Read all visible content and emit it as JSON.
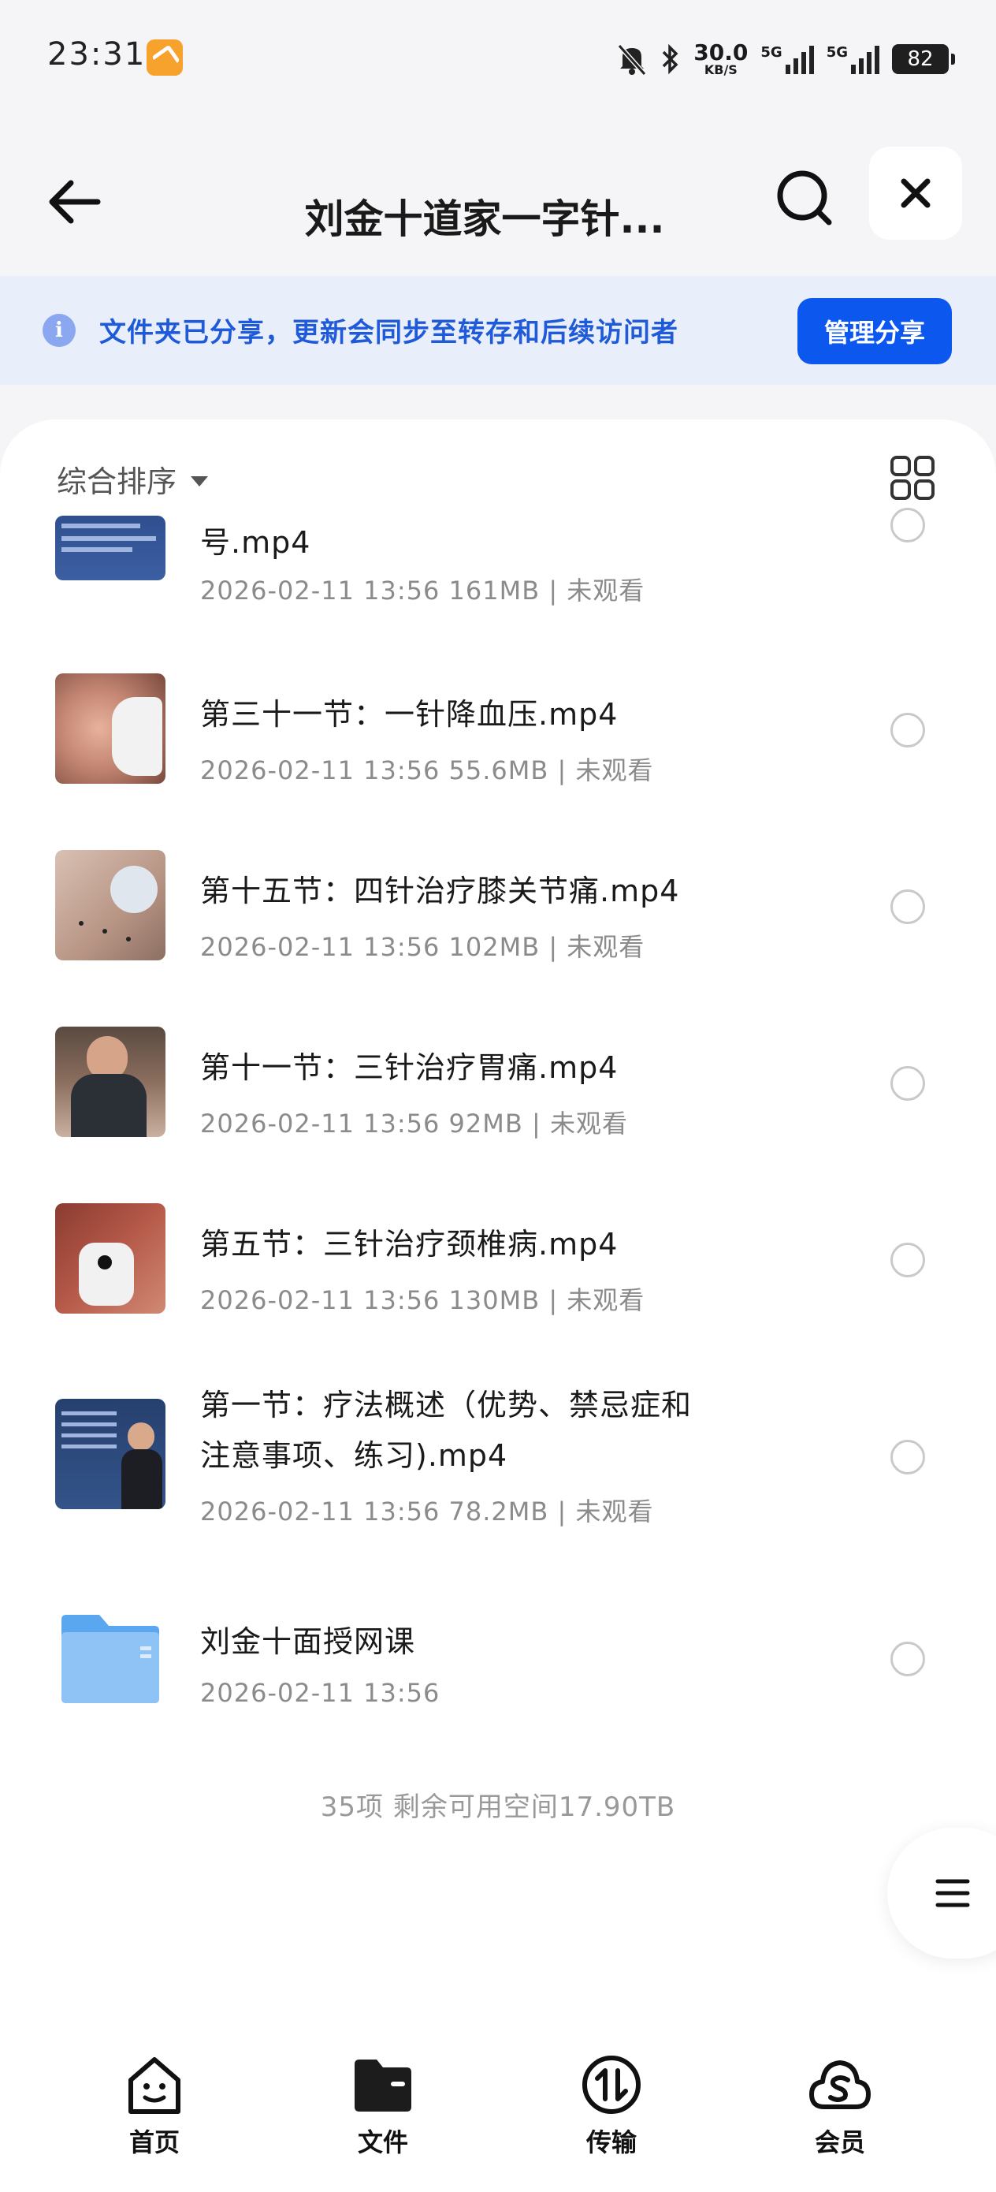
{
  "status": {
    "time": "23:31",
    "net_speed_value": "30.0",
    "net_speed_unit": "KB/S",
    "sig1": "5G",
    "sig2": "5G",
    "battery": "82"
  },
  "header": {
    "title": "刘金十道家一字针..."
  },
  "banner": {
    "text": "文件夹已分享，更新会同步至转存和后续访问者",
    "manage_label": "管理分享"
  },
  "sort": {
    "label": "综合排序"
  },
  "files": [
    {
      "name": "号.mp4",
      "meta": "2026-02-11 13:56  161MB | 未观看",
      "thumb": "slide"
    },
    {
      "name": "第三十一节：一针降血压.mp4",
      "meta": "2026-02-11 13:56  55.6MB | 未观看",
      "thumb": "face"
    },
    {
      "name": "第十五节：四针治疗膝关节痛.mp4",
      "meta": "2026-02-11 13:56  102MB | 未观看",
      "thumb": "knee"
    },
    {
      "name": "第十一节：三针治疗胃痛.mp4",
      "meta": "2026-02-11 13:56  92MB | 未观看",
      "thumb": "doctor"
    },
    {
      "name": "第五节：三针治疗颈椎病.mp4",
      "meta": "2026-02-11 13:56  130MB | 未观看",
      "thumb": "neck"
    },
    {
      "name_line1": "第一节：疗法概述（优势、禁忌症和",
      "name_line2": "注意事项、练习).mp4",
      "meta": "2026-02-11 13:56  78.2MB | 未观看",
      "thumb": "lecture"
    },
    {
      "name": "刘金十面授网课",
      "meta": "2026-02-11 13:56",
      "thumb": "folder"
    }
  ],
  "summary": "35项 剩余可用空间17.90TB",
  "nav": [
    {
      "label": "首页",
      "icon": "home-face-icon"
    },
    {
      "label": "文件",
      "icon": "folder-icon"
    },
    {
      "label": "传输",
      "icon": "transfer-icon"
    },
    {
      "label": "会员",
      "icon": "vip-cloud-icon"
    }
  ]
}
